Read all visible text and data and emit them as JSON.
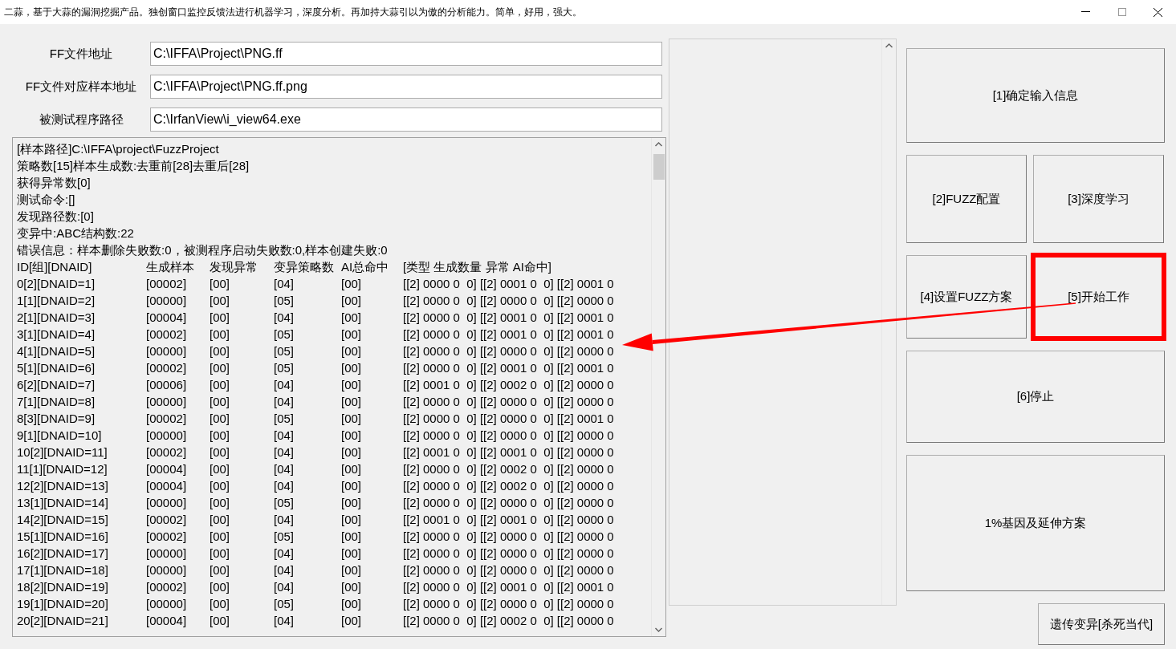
{
  "window": {
    "title": "二蒜，基于大蒜的漏洞挖掘产品。独创窗口监控反馈法进行机器学习，深度分析。再加持大蒜引以为傲的分析能力。简单，好用，强大。"
  },
  "fields": [
    {
      "label": "FF文件地址",
      "value": "C:\\IFFA\\Project\\PNG.ff"
    },
    {
      "label": "FF文件对应样本地址",
      "value": "C:\\IFFA\\Project\\PNG.ff.png"
    },
    {
      "label": "被测试程序路径",
      "value": "C:\\IrfanView\\i_view64.exe"
    }
  ],
  "log": {
    "lines": [
      "[样本路径]C:\\IFFA\\project\\FuzzProject",
      "策略数[15]样本生成数:去重前[28]去重后[28]",
      "获得异常数[0]",
      "测试命令:[]",
      "发现路径数:[0]",
      "变异中:ABC结构数:22",
      "错误信息：样本删除失败数:0，被测程序启动失败数:0,样本创建失败:0"
    ],
    "columns": [
      "ID[组][DNAID]",
      "生成样本",
      "发现异常",
      "变异策略数",
      "AI总命中",
      "[类型 生成数量 异常 AI命中]"
    ],
    "rows": [
      [
        "0[2][DNAID=1]",
        "[00002]",
        "[00]",
        "[04]",
        "[00]",
        "[[2] 0000 0  0] [[2] 0001 0  0] [[2] 0001 0"
      ],
      [
        "1[1][DNAID=2]",
        "[00000]",
        "[00]",
        "[05]",
        "[00]",
        "[[2] 0000 0  0] [[2] 0000 0  0] [[2] 0000 0"
      ],
      [
        "2[1][DNAID=3]",
        "[00004]",
        "[00]",
        "[04]",
        "[00]",
        "[[2] 0000 0  0] [[2] 0001 0  0] [[2] 0001 0"
      ],
      [
        "3[1][DNAID=4]",
        "[00002]",
        "[00]",
        "[05]",
        "[00]",
        "[[2] 0000 0  0] [[2] 0001 0  0] [[2] 0001 0"
      ],
      [
        "4[1][DNAID=5]",
        "[00000]",
        "[00]",
        "[05]",
        "[00]",
        "[[2] 0000 0  0] [[2] 0000 0  0] [[2] 0000 0"
      ],
      [
        "5[1][DNAID=6]",
        "[00002]",
        "[00]",
        "[05]",
        "[00]",
        "[[2] 0000 0  0] [[2] 0001 0  0] [[2] 0001 0"
      ],
      [
        "6[2][DNAID=7]",
        "[00006]",
        "[00]",
        "[04]",
        "[00]",
        "[[2] 0001 0  0] [[2] 0002 0  0] [[2] 0000 0"
      ],
      [
        "7[1][DNAID=8]",
        "[00000]",
        "[00]",
        "[04]",
        "[00]",
        "[[2] 0000 0  0] [[2] 0000 0  0] [[2] 0000 0"
      ],
      [
        "8[3][DNAID=9]",
        "[00002]",
        "[00]",
        "[05]",
        "[00]",
        "[[2] 0000 0  0] [[2] 0000 0  0] [[2] 0001 0"
      ],
      [
        "9[1][DNAID=10]",
        "[00000]",
        "[00]",
        "[04]",
        "[00]",
        "[[2] 0000 0  0] [[2] 0000 0  0] [[2] 0000 0"
      ],
      [
        "10[2][DNAID=11]",
        "[00002]",
        "[00]",
        "[04]",
        "[00]",
        "[[2] 0001 0  0] [[2] 0001 0  0] [[2] 0000 0"
      ],
      [
        "11[1][DNAID=12]",
        "[00004]",
        "[00]",
        "[04]",
        "[00]",
        "[[2] 0000 0  0] [[2] 0002 0  0] [[2] 0000 0"
      ],
      [
        "12[2][DNAID=13]",
        "[00004]",
        "[00]",
        "[04]",
        "[00]",
        "[[2] 0000 0  0] [[2] 0002 0  0] [[2] 0000 0"
      ],
      [
        "13[1][DNAID=14]",
        "[00000]",
        "[00]",
        "[05]",
        "[00]",
        "[[2] 0000 0  0] [[2] 0000 0  0] [[2] 0000 0"
      ],
      [
        "14[2][DNAID=15]",
        "[00002]",
        "[00]",
        "[04]",
        "[00]",
        "[[2] 0001 0  0] [[2] 0001 0  0] [[2] 0000 0"
      ],
      [
        "15[1][DNAID=16]",
        "[00002]",
        "[00]",
        "[05]",
        "[00]",
        "[[2] 0000 0  0] [[2] 0000 0  0] [[2] 0000 0"
      ],
      [
        "16[2][DNAID=17]",
        "[00000]",
        "[00]",
        "[04]",
        "[00]",
        "[[2] 0000 0  0] [[2] 0000 0  0] [[2] 0000 0"
      ],
      [
        "17[1][DNAID=18]",
        "[00000]",
        "[00]",
        "[04]",
        "[00]",
        "[[2] 0000 0  0] [[2] 0000 0  0] [[2] 0000 0"
      ],
      [
        "18[2][DNAID=19]",
        "[00002]",
        "[00]",
        "[04]",
        "[00]",
        "[[2] 0000 0  0] [[2] 0001 0  0] [[2] 0001 0"
      ],
      [
        "19[1][DNAID=20]",
        "[00000]",
        "[00]",
        "[05]",
        "[00]",
        "[[2] 0000 0  0] [[2] 0000 0  0] [[2] 0000 0"
      ],
      [
        "20[2][DNAID=21]",
        "[00004]",
        "[00]",
        "[04]",
        "[00]",
        "[[2] 0000 0  0] [[2] 0002 0  0] [[2] 0000 0"
      ]
    ]
  },
  "button_rows": [
    [
      {
        "label": "[1]确定输入信息",
        "highlighted": false
      }
    ],
    [
      {
        "label": "[2]FUZZ配置",
        "highlighted": false
      },
      {
        "label": "[3]深度学习",
        "highlighted": false
      }
    ],
    [
      {
        "label": "[4]设置FUZZ方案",
        "highlighted": false
      },
      {
        "label": "[5]开始工作",
        "highlighted": true
      }
    ],
    [
      {
        "label": "[6]停止",
        "highlighted": false
      }
    ],
    [
      {
        "label": "1%基因及延伸方案",
        "highlighted": false
      }
    ],
    [
      {
        "label": "遗传变异[杀死当代]",
        "highlighted": false
      }
    ]
  ]
}
